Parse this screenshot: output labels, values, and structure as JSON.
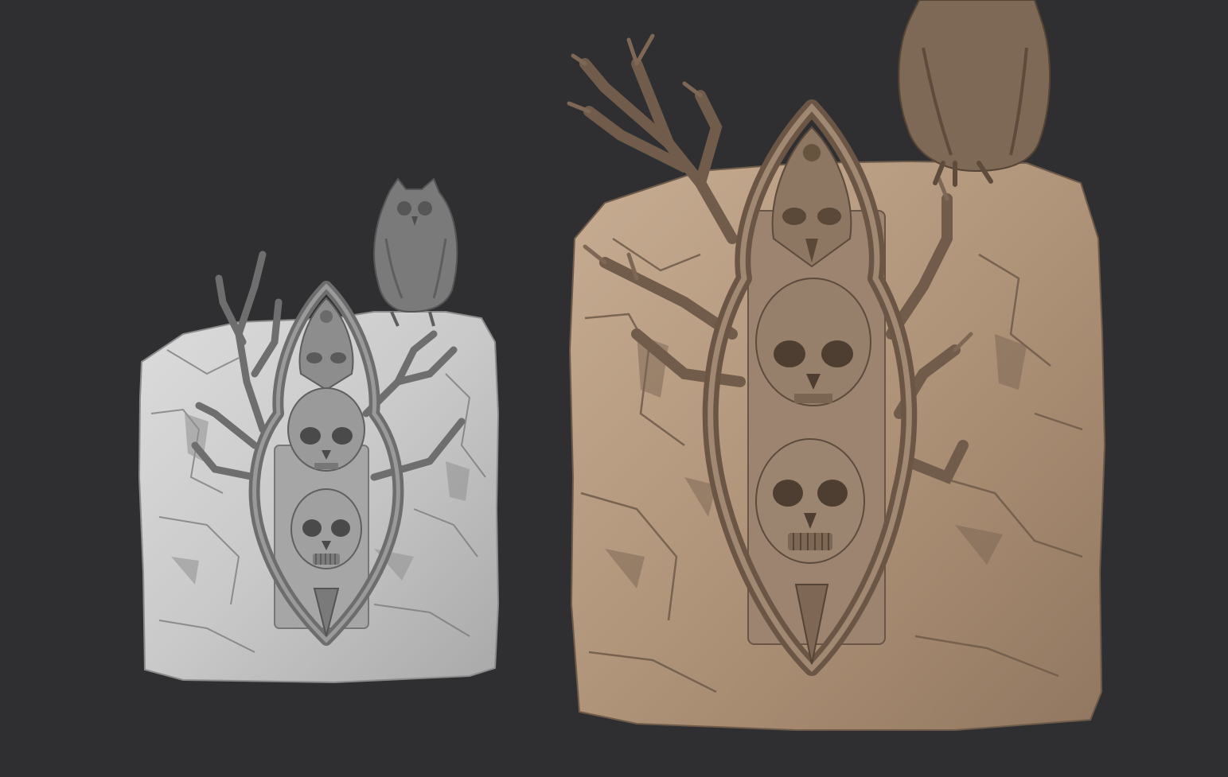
{
  "scene": {
    "background": "#2f2f31",
    "models": [
      {
        "name": "sculpt-left",
        "material": "grey-clay",
        "base": "#cfcfcf",
        "shade": "#8e8e8e",
        "dark": "#5b5b5b"
      },
      {
        "name": "sculpt-right",
        "material": "brown-clay",
        "base": "#b59a80",
        "shade": "#8a725d",
        "dark": "#5a4a3c"
      }
    ]
  }
}
